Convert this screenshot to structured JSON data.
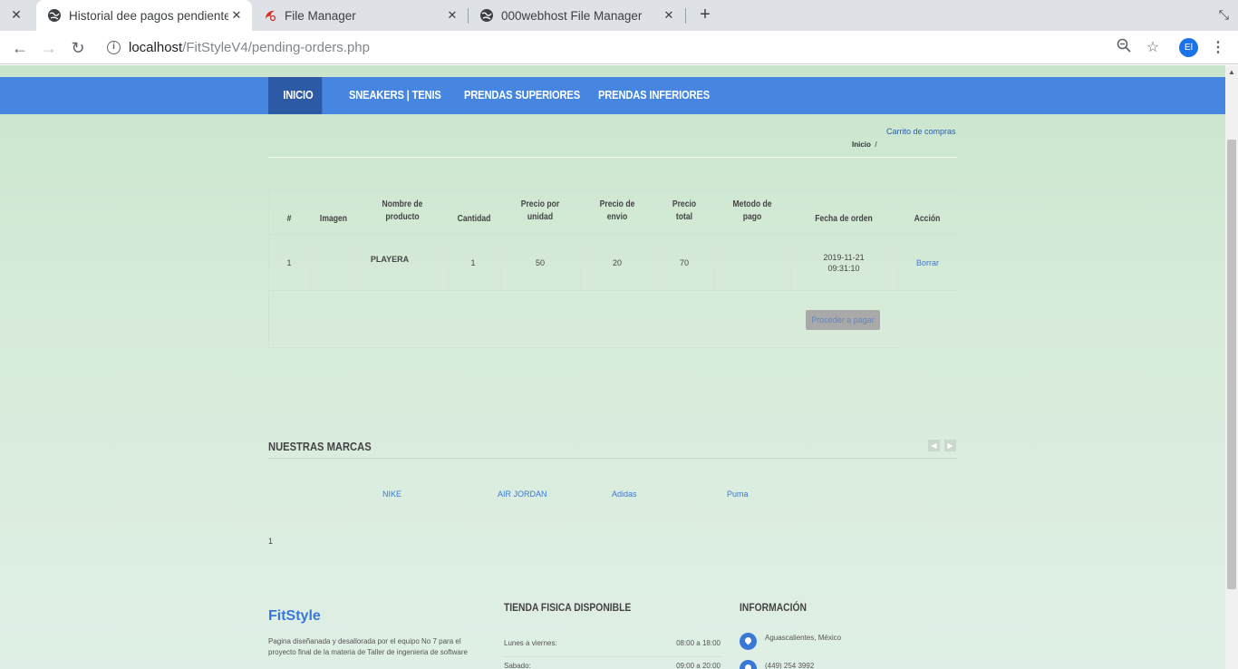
{
  "browser": {
    "tabs": [
      {
        "title": "Historial dee pagos pendientes",
        "active": true,
        "icon": "globe-icon"
      },
      {
        "title": "File Manager",
        "active": false,
        "icon": "file-manager-icon"
      },
      {
        "title": "000webhost File Manager",
        "active": false,
        "icon": "globe-icon"
      }
    ],
    "url_host": "localhost",
    "url_path": "/FitStyleV4/pending-orders.php",
    "profile_initials": "El"
  },
  "nav": {
    "items": [
      "INICIO",
      "SNEAKERS | TENIS",
      "PRENDAS SUPERIORES",
      "PRENDAS INFERIORES"
    ],
    "active_index": 0
  },
  "header": {
    "cart_link": "Carrito de compras",
    "breadcrumb_home": "Inicio",
    "breadcrumb_sep": "/"
  },
  "orders_table": {
    "columns": [
      "#",
      "Imagen",
      "Nombre de producto",
      "Cantidad",
      "Precio por unidad",
      "Precio de envio",
      "Precio total",
      "Metodo de pago",
      "Fecha de orden",
      "Acción"
    ],
    "rows": [
      {
        "num": "1",
        "image": "",
        "product": "PLAYERA",
        "quantity": "1",
        "unit_price": "50",
        "shipping": "20",
        "total": "70",
        "payment_method": "",
        "date": "2019-11-21",
        "time": "09:31:10",
        "action": "Borrar"
      }
    ],
    "pay_button": "Proceder a pagar"
  },
  "brands": {
    "title": "NUESTRAS MARCAS",
    "items": [
      "NIKE",
      "AIR JORDAN",
      "Adidas",
      "Puma"
    ],
    "page": "1"
  },
  "footer": {
    "brand": "FitStyle",
    "description": "Pagina diseñanada y desallorada por el equipo No 7 para el proyecto final de la materia de Taller de ingenieria de software",
    "store_title": "TIENDA FISICA DISPONIBLE",
    "hours": [
      {
        "day": "Lunes a viernes:",
        "time": "08:00 a 18:00"
      },
      {
        "day": "Sabado:",
        "time": "09:00 a 20:00"
      }
    ],
    "info_title": "INFORMACIÓN",
    "info": [
      {
        "icon": "location-pin-icon",
        "text": "Aguascalientes, México"
      },
      {
        "icon": "phone-icon",
        "text": "(449) 254 3992"
      }
    ]
  }
}
